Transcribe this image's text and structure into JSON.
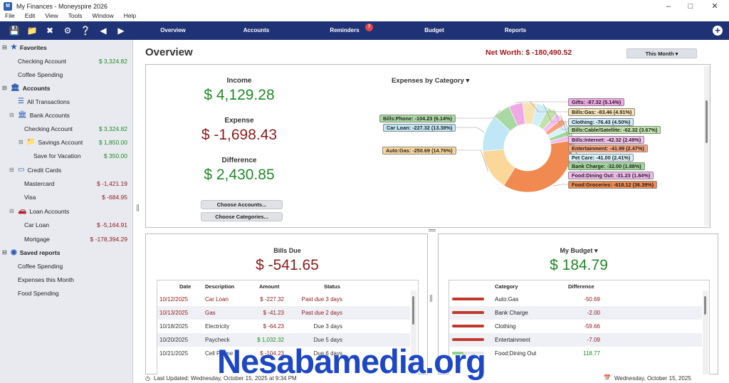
{
  "window": {
    "title": "My Finances - Moneyspire 2026",
    "app_icon": "M"
  },
  "menu": [
    "File",
    "Edit",
    "View",
    "Tools",
    "Window",
    "Help"
  ],
  "toolbar": {
    "icons": [
      "save-icon",
      "folder-icon",
      "tools-icon",
      "gear-icon",
      "help-icon",
      "back-icon",
      "forward-icon"
    ],
    "tabs": [
      "Overview",
      "Accounts",
      "Reminders",
      "Budget",
      "Reports"
    ],
    "reminders_badge": "7",
    "accent": "#1f3276"
  },
  "sidebar": {
    "favorites": {
      "label": "Favorites",
      "items": [
        {
          "label": "Checking Account",
          "amount": "$ 3,324.82"
        },
        {
          "label": "Coffee Spending",
          "amount": ""
        }
      ]
    },
    "accounts": {
      "label": "Accounts",
      "all": "All Transactions",
      "bank": {
        "label": "Bank Accounts",
        "checking": "Checking Account",
        "checking_amt": "$ 3,324.82",
        "savings": "Savings Account",
        "savings_amt": "$ 1,850.00",
        "vacation": "Save for Vacation",
        "vacation_amt": "$ 350.00"
      },
      "credit": {
        "label": "Credit Cards",
        "mastercard": "Mastercard",
        "mastercard_amt": "$ -1,421.19",
        "visa": "Visa",
        "visa_amt": "$ -684.95"
      },
      "loan": {
        "label": "Loan Accounts",
        "car": "Car Loan",
        "car_amt": "$ -5,164.91",
        "mortgage": "Mortgage",
        "mortgage_amt": "$ -178,394.29"
      }
    },
    "reports": {
      "label": "Saved reports",
      "items": [
        "Coffee Spending",
        "Expenses this Month",
        "Food Spending"
      ]
    }
  },
  "overview": {
    "title": "Overview",
    "net_worth": "Net Worth: $ -180,490.52",
    "period": "This Month",
    "income_label": "Income",
    "income": "$ 4,129.28",
    "expense_label": "Expense",
    "expense": "$ -1,698.43",
    "difference_label": "Difference",
    "difference": "$ 2,430.85",
    "choose_accounts": "Choose Accounts...",
    "choose_categories": "Choose Categories..."
  },
  "chart_data": {
    "type": "pie",
    "title": "Expenses by Category",
    "donut": true,
    "slices": [
      {
        "label": "Food:Groceries",
        "value": -618.12,
        "pct": 36.39,
        "text": "Food:Groceries: -618.12 (36.39%)",
        "color": "#f08a50"
      },
      {
        "label": "Auto:Gas",
        "value": -250.69,
        "pct": 14.76,
        "text": "Auto:Gas: -250.69 (14.76%)",
        "color": "#fbd79a"
      },
      {
        "label": "Car Loan",
        "value": -227.32,
        "pct": 13.38,
        "text": "Car Loan: -227.32 (13.38%)",
        "color": "#bfe7f6"
      },
      {
        "label": "Bills:Phone",
        "value": -104.23,
        "pct": 6.14,
        "text": "Bills:Phone: -104.23 (6.14%)",
        "color": "#a9d9a0"
      },
      {
        "label": "Gifts",
        "value": -87.32,
        "pct": 5.14,
        "text": "Gifts: -87.32 (5.14%)",
        "color": "#f0a8e6"
      },
      {
        "label": "Bills:Gas",
        "value": -83.46,
        "pct": 4.91,
        "text": "Bills:Gas: -83.46 (4.91%)",
        "color": "#f7e2b4"
      },
      {
        "label": "Clothing",
        "value": -76.43,
        "pct": 4.5,
        "text": "Clothing: -76.43 (4.50%)",
        "color": "#cfeef9"
      },
      {
        "label": "Bills:Cable/Satellite",
        "value": -62.32,
        "pct": 3.67,
        "text": "Bills:Cable/Satellite: -62.32 (3.67%)",
        "color": "#bfe3a8"
      },
      {
        "label": "Bills:Internet",
        "value": -42.32,
        "pct": 2.49,
        "text": "Bills:Internet: -42.32 (2.49%)",
        "color": "#f6bff0"
      },
      {
        "label": "Entertainment",
        "value": -41.99,
        "pct": 2.47,
        "text": "Entertainment: -41.99 (2.47%)",
        "color": "#f7a27c"
      },
      {
        "label": "Pet Care",
        "value": -41.0,
        "pct": 2.41,
        "text": "Pet Care: -41.00 (2.41%)",
        "color": "#d6f2fb"
      },
      {
        "label": "Bank Charge",
        "value": -32.0,
        "pct": 1.88,
        "text": "Bank Charge: -32.00 (1.88%)",
        "color": "#9fd79a"
      },
      {
        "label": "Food:Dining Out",
        "value": -31.23,
        "pct": 1.84,
        "text": "Food:Dining Out: -31.23 (1.84%)",
        "color": "#f4b9ef"
      }
    ]
  },
  "bills": {
    "title": "Bills Due",
    "total": "$ -541.65",
    "headers": [
      "Date",
      "Description",
      "Amount",
      "Status"
    ],
    "rows": [
      {
        "date": "10/12/2025",
        "desc": "Car Loan",
        "amount": "$ -227.32",
        "status": "Past due 3 days",
        "overdue": true
      },
      {
        "date": "10/13/2025",
        "desc": "Gas",
        "amount": "$ -41.23",
        "status": "Past due 2 days",
        "overdue": true
      },
      {
        "date": "10/18/2025",
        "desc": "Electricity",
        "amount": "$ -64.23",
        "status": "Due 3 days",
        "overdue": false
      },
      {
        "date": "10/20/2025",
        "desc": "Paycheck",
        "amount": "$ 1,032.32",
        "status": "Due 5 days",
        "overdue": false
      },
      {
        "date": "10/21/2025",
        "desc": "Cell Phone",
        "amount": "$ -104.23",
        "status": "Due 6 days",
        "overdue": false
      }
    ]
  },
  "budget": {
    "title": "My Budget",
    "total": "$ 184.79",
    "headers": [
      "Category",
      "Difference"
    ],
    "rows": [
      {
        "category": "Auto:Gas",
        "diff": "-50.69",
        "fill": 1.0,
        "over": true
      },
      {
        "category": "Bank Charge",
        "diff": "-2.00",
        "fill": 1.0,
        "over": true
      },
      {
        "category": "Clothing",
        "diff": "-59.66",
        "fill": 1.0,
        "over": true
      },
      {
        "category": "Entertainment",
        "diff": "-7.09",
        "fill": 1.0,
        "over": true
      },
      {
        "category": "Food:Dining Out",
        "diff": "118.77",
        "fill": 0.35,
        "over": false
      }
    ]
  },
  "status": {
    "updated": "Last Updated: Wednesday, October 15, 2025 at 9:34 PM",
    "date": "Wednesday, October 15, 2025"
  },
  "watermark": "Nesabamedia.org"
}
